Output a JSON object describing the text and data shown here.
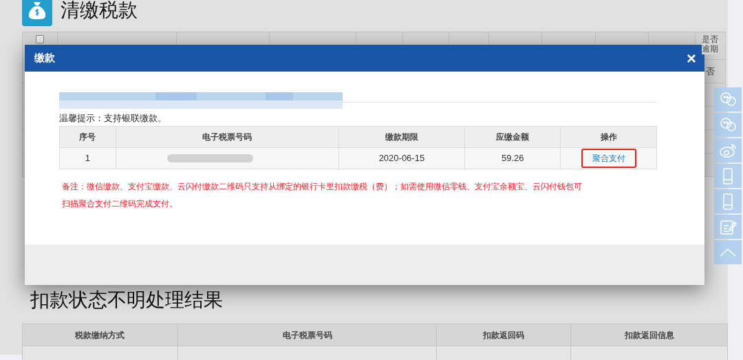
{
  "page": {
    "title": "清缴税款"
  },
  "background_table": {
    "select_all_checked": false,
    "last_column": "是否逾期",
    "rows": [
      {
        "overdue": "否"
      }
    ]
  },
  "modal": {
    "title": "缴款",
    "close": "×",
    "hint": "温馨提示：支持银联缴款。",
    "table": {
      "columns": [
        "序号",
        "电子税票号码",
        "缴款期限",
        "应缴金额",
        "操作"
      ],
      "rows": [
        {
          "index": "1",
          "due_date": "2020-06-15",
          "amount": "59.26",
          "action": "聚合支付"
        }
      ]
    },
    "note_lines": [
      "备注：微信缴款、支付宝缴款、云闪付缴款二维码只支持从绑定的银行卡里扣款缴税（费）；如需使用微信零钱、支付宝余额宝、云闪付钱包可",
      "扫描聚合支付二维码完成支付。"
    ]
  },
  "section": {
    "title": "扣款状态不明处理结果",
    "columns": [
      "税款缴纳方式",
      "电子税票号码",
      "扣款返回码",
      "扣款返回信息"
    ]
  }
}
